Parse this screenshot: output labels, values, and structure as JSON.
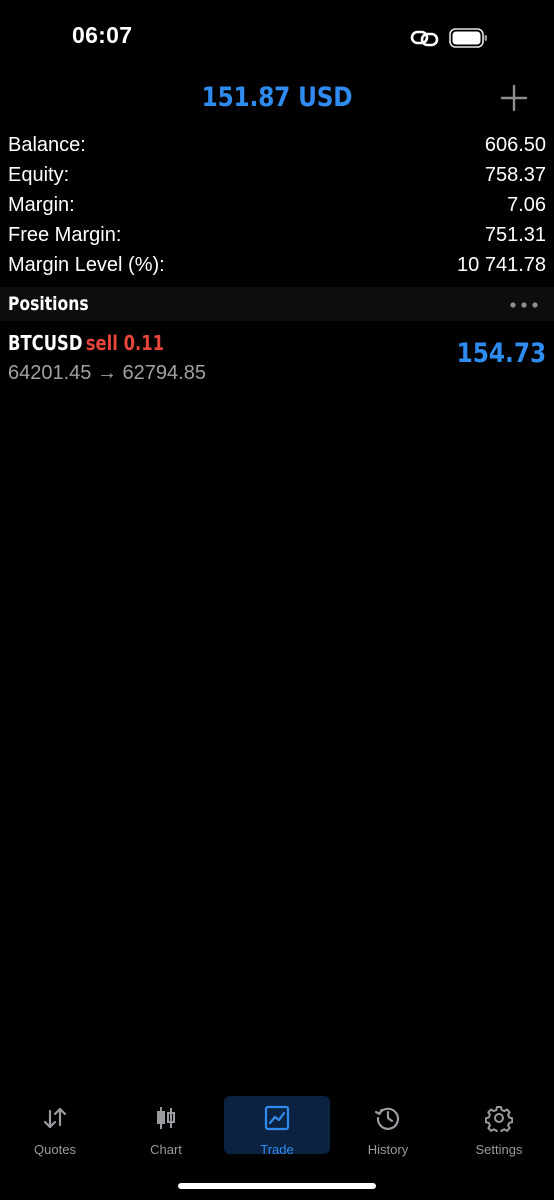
{
  "status_bar": {
    "time": "06:07"
  },
  "header": {
    "total": "151.87 USD"
  },
  "summary": [
    {
      "label": "Balance:",
      "value": "606.50"
    },
    {
      "label": "Equity:",
      "value": "758.37"
    },
    {
      "label": "Margin:",
      "value": "7.06"
    },
    {
      "label": "Free Margin:",
      "value": "751.31"
    },
    {
      "label": "Margin Level (%):",
      "value": "10 741.78"
    }
  ],
  "positions": {
    "title": "Positions",
    "items": [
      {
        "symbol": "BTCUSD",
        "side_volume": "sell 0.11",
        "prices": "64201.45 → 62794.85",
        "profit": "154.73"
      }
    ]
  },
  "tabs": [
    {
      "label": "Quotes",
      "icon": "quotes-icon"
    },
    {
      "label": "Chart",
      "icon": "candlestick-icon"
    },
    {
      "label": "Trade",
      "icon": "trade-icon",
      "active": true
    },
    {
      "label": "History",
      "icon": "history-icon"
    },
    {
      "label": "Settings",
      "icon": "gear-icon"
    }
  ],
  "colors": {
    "accent": "#2f8bf0",
    "sell": "#e8453c",
    "secondary_text": "#a0a0a5"
  }
}
